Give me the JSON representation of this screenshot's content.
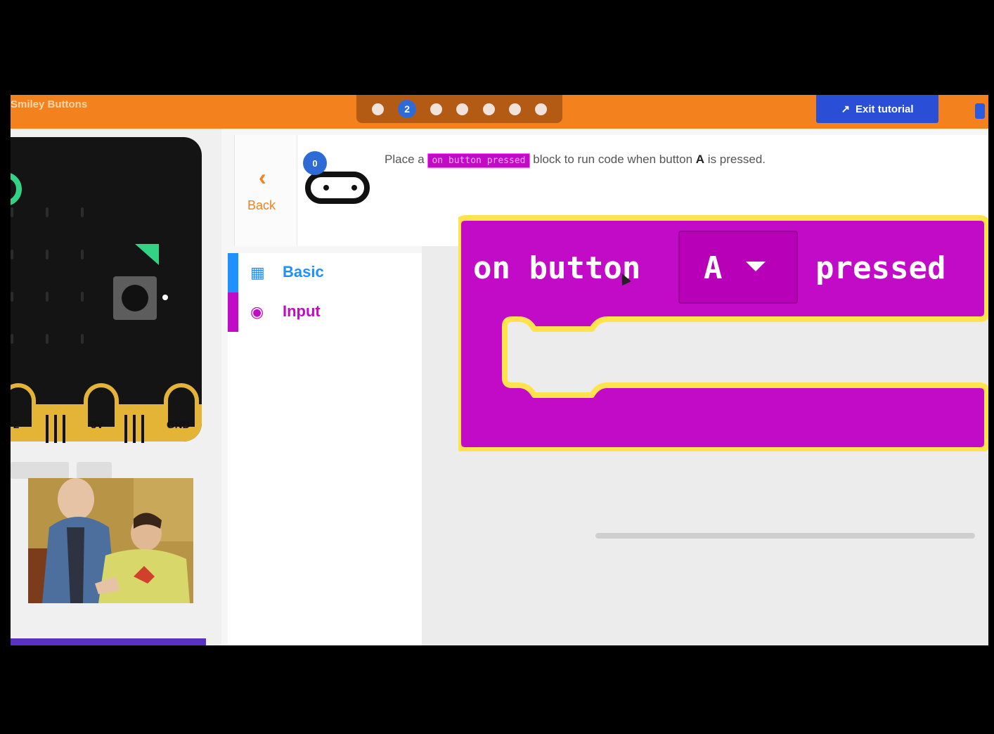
{
  "header": {
    "project_title": "Smiley Buttons",
    "current_step": "2",
    "exit_label": "Exit tutorial"
  },
  "simulator": {
    "pin_labels": [
      "2",
      "3V",
      "GND"
    ]
  },
  "hint": {
    "back_label": "Back",
    "step_badge": "0",
    "text_before": "Place a ",
    "block_name": "on button pressed",
    "text_middle": " block to run code when button ",
    "bold_button": "A",
    "text_after": " is pressed."
  },
  "toolbox": {
    "categories": [
      {
        "label": "Basic",
        "color": "#1e90ff"
      },
      {
        "label": "Input",
        "color": "#c20bc7"
      }
    ]
  },
  "block": {
    "label_on": "on button",
    "dropdown_value": "A",
    "label_pressed": "pressed",
    "color": "#c20bc7",
    "outline": "#ffe34d"
  },
  "colors": {
    "header": "#f3821e",
    "exit_button": "#2a4fd6",
    "step_active": "#2f6bd7",
    "microbit_logo": "#33d386",
    "pin_gold": "#e3b436"
  }
}
